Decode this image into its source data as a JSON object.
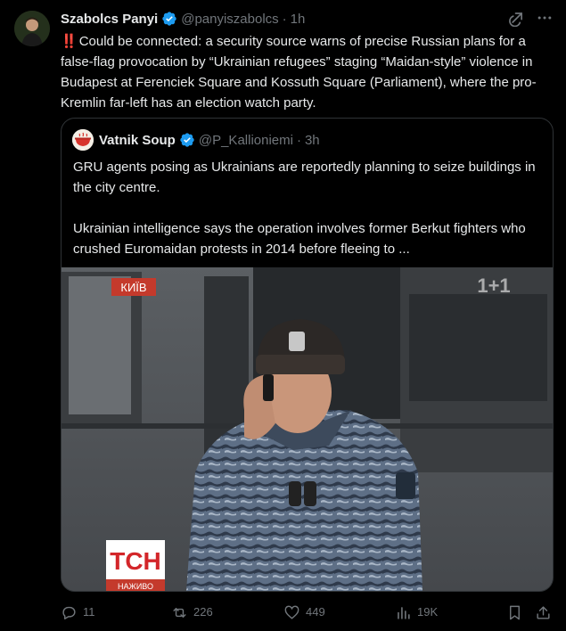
{
  "tweet": {
    "author_name": "Szabolcs Panyi",
    "author_handle": "@panyiszabolcs",
    "separator": "·",
    "time": "1h",
    "alert_glyph": "‼️",
    "text": "Could be connected: a security source warns of precise Russian plans for a false-flag provocation by “Ukrainian refugees” staging “Maidan-style” violence in Budapest at Ferenciek Square and Kossuth Square (Parliament), where the pro-Kremlin far-left has an election watch party.",
    "avatar_icon": "profile-photo",
    "top_icons": [
      "grok-icon",
      "more-icon"
    ]
  },
  "quote": {
    "author_name": "Vatnik Soup",
    "author_handle": "@P_Kallioniemi",
    "separator": "·",
    "time": "3h",
    "paragraphs": [
      "GRU agents posing as Ukrainians are reportedly planning to seize buildings in the city centre.",
      "Ukrainian intelligence says the operation involves former Berkut fighters who crushed Euromaidan protests in 2014 before fleeing to ..."
    ],
    "media": {
      "location_label": "КИЇВ",
      "channel_logo": "1+1",
      "news_logo": "ТСН",
      "live_label": "НАЖИВО"
    }
  },
  "actions": {
    "replies": "11",
    "reposts": "226",
    "likes": "449",
    "views": "19K"
  },
  "colors": {
    "background": "#000000",
    "text": "#e7e9ea",
    "muted": "#71767b",
    "verified": "#1d9bf0",
    "border": "#2f3336",
    "alert": "#f4212e"
  }
}
